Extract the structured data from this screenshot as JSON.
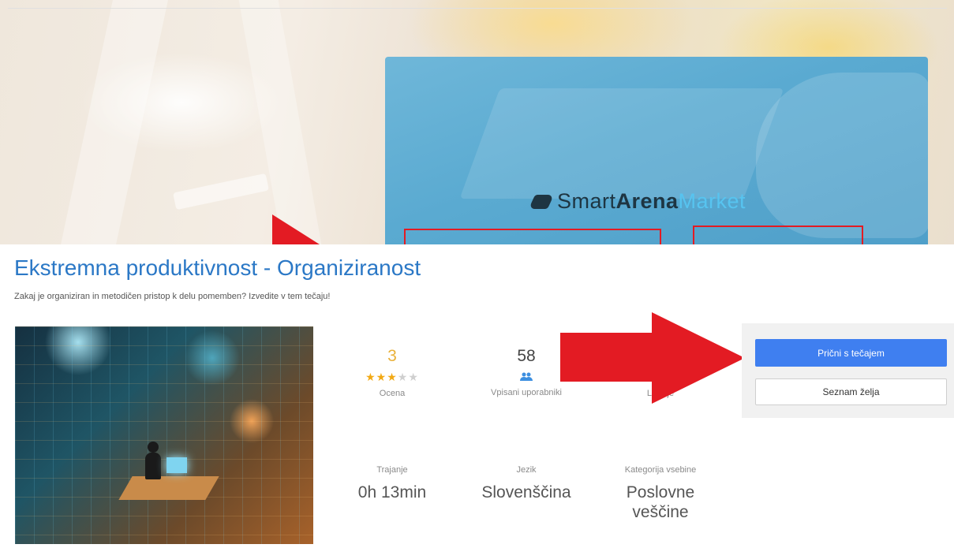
{
  "banner": {
    "logo": {
      "smart": "Smart",
      "arena": "Arena",
      "market": "Market"
    }
  },
  "course": {
    "title": "Ekstremna produktivnost - Organiziranost",
    "subtitle": "Zakaj je organiziran in metodičen pristop k delu pomemben? Izvedite v tem tečaju!"
  },
  "stats": {
    "rating": {
      "value": "3",
      "stars": 3,
      "max_stars": 5,
      "label": "Ocena"
    },
    "enrolled": {
      "value": "58",
      "label": "Vpisani uporabniki",
      "icon": "users-icon"
    },
    "lessons": {
      "value": "",
      "label": "Lekcije",
      "icon": "monitor-icon"
    }
  },
  "meta": {
    "duration": {
      "label": "Trajanje",
      "value": "0h 13min"
    },
    "language": {
      "label": "Jezik",
      "value": "Slovenščina"
    },
    "category": {
      "label": "Kategorija vsebine",
      "value": "Poslovne veščine"
    }
  },
  "actions": {
    "start_label": "Prični s tečajem",
    "wishlist_label": "Seznam želja"
  },
  "colors": {
    "title": "#2b78c6",
    "primary_button": "#3f7ff0",
    "star": "#f2a914",
    "annotation_red": "#e31b23",
    "icon_blue": "#3d8fe0"
  }
}
